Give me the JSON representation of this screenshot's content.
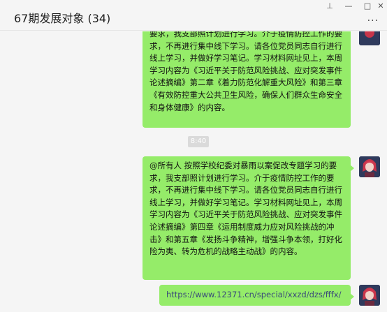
{
  "window": {
    "title": "67期发展对象 (34)",
    "pin": "⊥",
    "minimize": "—",
    "maximize": "□",
    "close": "✕",
    "more": "···"
  },
  "messages": [
    {
      "text": "要求，我支部照计划进行学习。介于疫情防控工作的要求，不再进行集中线下学习。请各位党员同志自行进行线上学习，并做好学习笔记。学习材料网址见上，本周学习内容为《习近平关于防范风险挑战、应对突发事件论述摘编》第二章《着力防范化解重大风险》和第三章《有效防控重大公共卫生风险，确保人们群众生命安全和身体健康》的内容。"
    },
    {
      "text": "@所有人 按照学校纪委对暴雨以案促改专题学习的要求，我支部照计划进行学习。介于疫情防控工作的要求，不再进行集中线下学习。请各位党员同志自行进行线上学习，并做好学习笔记。学习材料网址见上，本周学习内容为《习近平关于防范风险挑战、应对突发事件论述摘编》第四章《运用制度威力应对风险挑战的冲击》和第五章《发扬斗争精神，增强斗争本领，打好化险为夷、转为危机的战略主动战》的内容。"
    },
    {
      "text": "https://www.12371.cn/special/xxzd/dzs/fffx/"
    }
  ],
  "time_divider": "8:40",
  "colors": {
    "bubble": "#95ec69",
    "background": "#f5f5f5"
  }
}
